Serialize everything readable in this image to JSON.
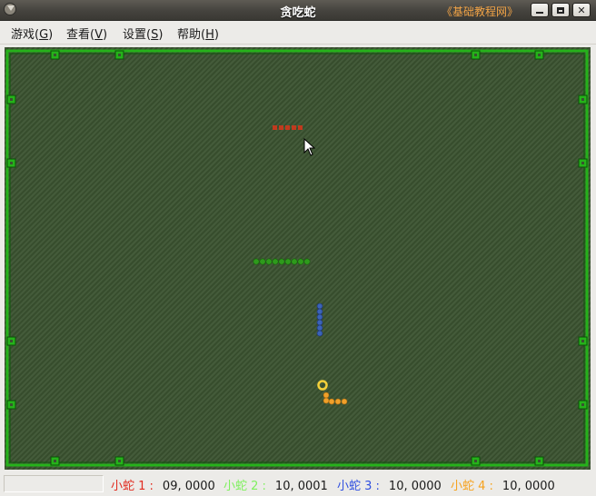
{
  "window": {
    "title": "贪吃蛇",
    "brand": "《基础教程网》",
    "minimize_label": "",
    "close_label": "✕"
  },
  "menu": [
    {
      "label": "游戏(",
      "accel": "G",
      "end": ")"
    },
    {
      "label": "查看(",
      "accel": "V",
      "end": ")"
    },
    {
      "label": "设置(",
      "accel": "S",
      "end": ")"
    },
    {
      "label": "帮助(",
      "accel": "H",
      "end": ")"
    }
  ],
  "game": {
    "background_color": "#3a5230",
    "wall_color": "#25b21a",
    "snakes": [
      {
        "name": "小蛇 1 :",
        "color": "#e12b1f",
        "score": "09, 0000"
      },
      {
        "name": "小蛇 2 :",
        "color": "#7ef05d",
        "score": "10, 0001"
      },
      {
        "name": "小蛇 3 :",
        "color": "#2f4fe0",
        "score": "10, 0000"
      },
      {
        "name": "小蛇 4 :",
        "color": "#f6a21d",
        "score": "10, 0000"
      }
    ],
    "snake_colors_on_board": {
      "red": "#c13a1e",
      "green": "#2e9a1c",
      "blue": "#3b63b8",
      "orange": "#f0a02a"
    },
    "pointer": "mouse-cursor"
  }
}
